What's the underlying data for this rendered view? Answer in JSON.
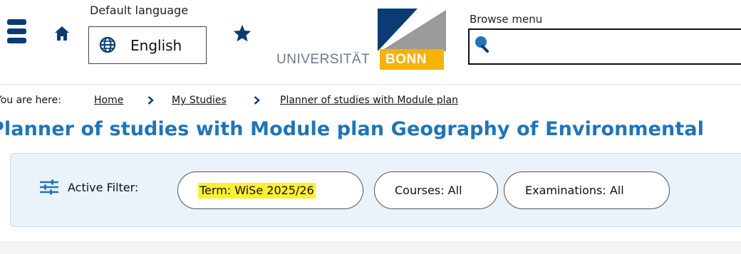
{
  "header": {
    "default_language_label": "Default language",
    "language_value": "English",
    "browse_menu_label": "Browse menu",
    "browse_menu_value": ""
  },
  "logo": {
    "university_text": "UNIVERSITÄT",
    "bonn_text": "BONN"
  },
  "breadcrumb": {
    "prefix": "You are here:",
    "items": [
      {
        "label": "Home"
      },
      {
        "label": "My Studies"
      },
      {
        "label": "Planner of studies with Module plan"
      }
    ]
  },
  "page": {
    "title": "Planner of studies with Module plan Geography of Environmental"
  },
  "filter": {
    "label": "Active Filter:",
    "pills": [
      {
        "label": "Term: WiSe 2025/26",
        "highlighted": true
      },
      {
        "label": "Courses: All",
        "highlighted": false
      },
      {
        "label": "Examinations: All",
        "highlighted": false
      }
    ]
  },
  "icons": {
    "menu": "hamburger-menu-icon",
    "home": "home-icon",
    "language": "globe-icon",
    "bookmark": "star-icon",
    "search": "search-icon",
    "filter": "filter-sliders-icon",
    "breadcrumb_separator": "chevron-right-icon"
  },
  "colors": {
    "brand_dark_blue": "#0a3b73",
    "title_blue": "#1f75b8",
    "bonn_yellow": "#f5b400",
    "filter_panel_bg": "#eaf2fa",
    "highlight": "#ffee33"
  }
}
